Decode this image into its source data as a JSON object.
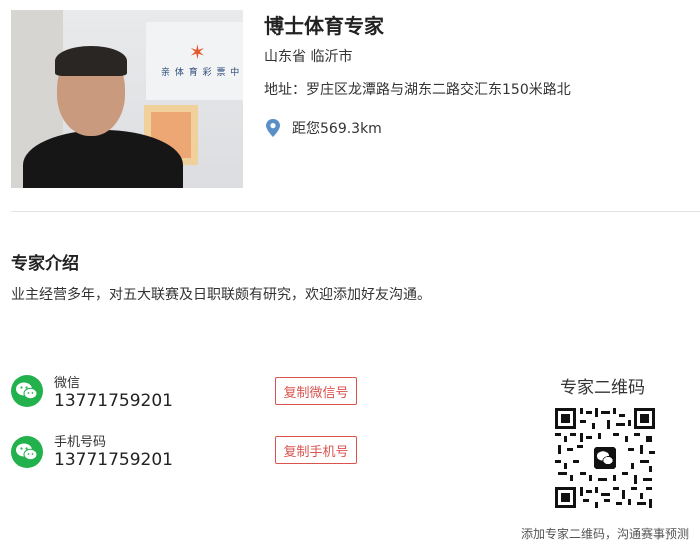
{
  "expert": {
    "name": "博士体育专家",
    "region": "山东省 临沂市",
    "address": "地址：罗庄区龙潭路与湖东二路交汇东150米路北",
    "distance": "距您569.3km",
    "photo_sign_text": "亲 体 育 彩 票 中"
  },
  "intro": {
    "title": "专家介绍",
    "text": "业主经营多年，对五大联赛及日职联颇有研究，欢迎添加好友沟通。"
  },
  "contacts": [
    {
      "label": "微信",
      "value": "13771759201",
      "button": "复制微信号",
      "icon": "wechat-icon"
    },
    {
      "label": "手机号码",
      "value": "13771759201",
      "button": "复制手机号",
      "icon": "wechat-icon"
    }
  ],
  "qr": {
    "title": "专家二维码",
    "caption": "添加专家二维码，沟通赛事预测"
  },
  "colors": {
    "accent_red": "#d9534f",
    "wechat_green": "#22b14c",
    "pin_blue": "#5b8fc7"
  }
}
